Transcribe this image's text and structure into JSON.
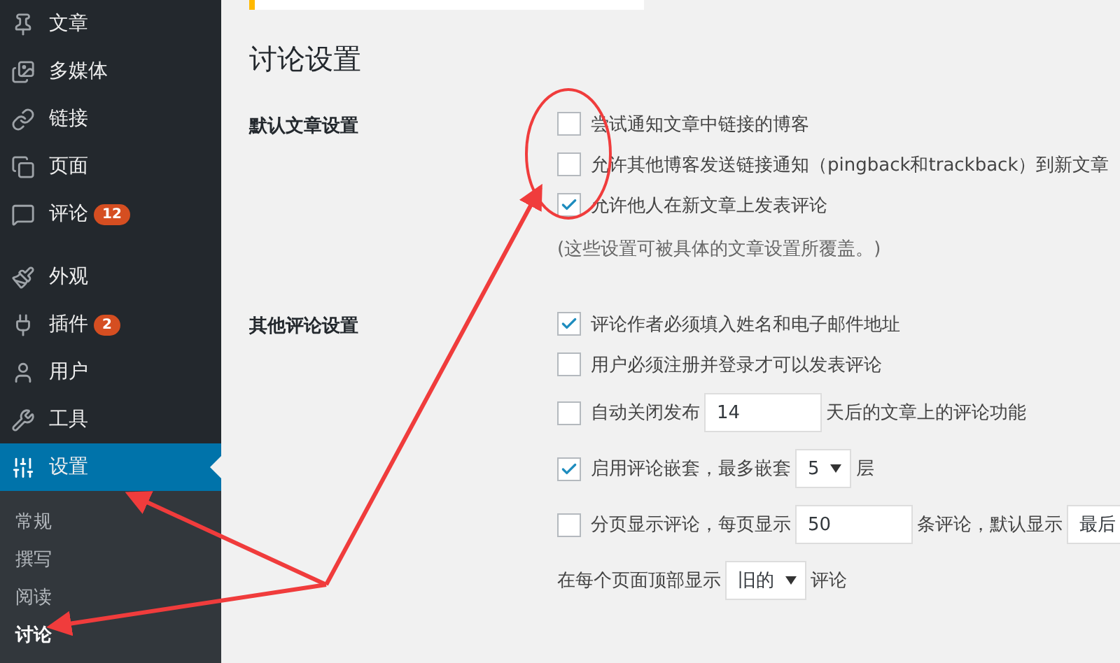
{
  "sidebar": {
    "items": [
      {
        "label": "文章",
        "selected": false
      },
      {
        "label": "多媒体",
        "selected": false
      },
      {
        "label": "链接",
        "selected": false
      },
      {
        "label": "页面",
        "selected": false
      },
      {
        "label": "评论",
        "badge": "12",
        "selected": false
      },
      {
        "label": "外观",
        "selected": false
      },
      {
        "label": "插件",
        "badge": "2",
        "selected": false
      },
      {
        "label": "用户",
        "selected": false
      },
      {
        "label": "工具",
        "selected": false
      },
      {
        "label": "设置",
        "selected": true
      }
    ],
    "submenu": [
      {
        "label": "常规",
        "selected": false
      },
      {
        "label": "撰写",
        "selected": false
      },
      {
        "label": "阅读",
        "selected": false
      },
      {
        "label": "讨论",
        "selected": true
      }
    ]
  },
  "page_title": "讨论设置",
  "sections": [
    {
      "label": "默认文章设置",
      "rows": [
        {
          "kind": "check",
          "checked": false,
          "parts": [
            {
              "kind": "text",
              "text": "尝试通知文章中链接的博客"
            }
          ]
        },
        {
          "kind": "check",
          "checked": false,
          "parts": [
            {
              "kind": "text",
              "text": "允许其他博客发送链接通知（pingback和trackback）到新文章"
            }
          ]
        },
        {
          "kind": "check",
          "checked": true,
          "parts": [
            {
              "kind": "text",
              "text": "允许他人在新文章上发表评论"
            }
          ]
        },
        {
          "kind": "note",
          "parts": [
            {
              "kind": "text",
              "text": "(这些设置可被具体的文章设置所覆盖。)"
            }
          ]
        }
      ]
    },
    {
      "label": "其他评论设置",
      "rows": [
        {
          "kind": "check",
          "checked": true,
          "parts": [
            {
              "kind": "text",
              "text": "评论作者必须填入姓名和电子邮件地址"
            }
          ]
        },
        {
          "kind": "check",
          "checked": false,
          "parts": [
            {
              "kind": "text",
              "text": "用户必须注册并登录才可以发表评论"
            }
          ]
        },
        {
          "kind": "check",
          "checked": false,
          "parts": [
            {
              "kind": "text",
              "text": "自动关闭发布"
            },
            {
              "kind": "input",
              "value": "14"
            },
            {
              "kind": "text",
              "text": "天后的文章上的评论功能"
            }
          ]
        },
        {
          "kind": "check",
          "checked": true,
          "parts": [
            {
              "kind": "text",
              "text": "启用评论嵌套，最多嵌套"
            },
            {
              "kind": "select",
              "value": "5"
            },
            {
              "kind": "text",
              "text": "层"
            }
          ]
        },
        {
          "kind": "check",
          "checked": false,
          "parts": [
            {
              "kind": "text",
              "text": "分页显示评论，每页显示"
            },
            {
              "kind": "input",
              "value": "50"
            },
            {
              "kind": "text",
              "text": "条评论，默认显示"
            },
            {
              "kind": "cutselect",
              "value": "最后"
            }
          ]
        },
        {
          "kind": "plain",
          "parts": [
            {
              "kind": "text",
              "text": "在每个页面顶部显示"
            },
            {
              "kind": "select",
              "value": "旧的"
            },
            {
              "kind": "text",
              "text": "评论"
            }
          ]
        }
      ]
    }
  ]
}
